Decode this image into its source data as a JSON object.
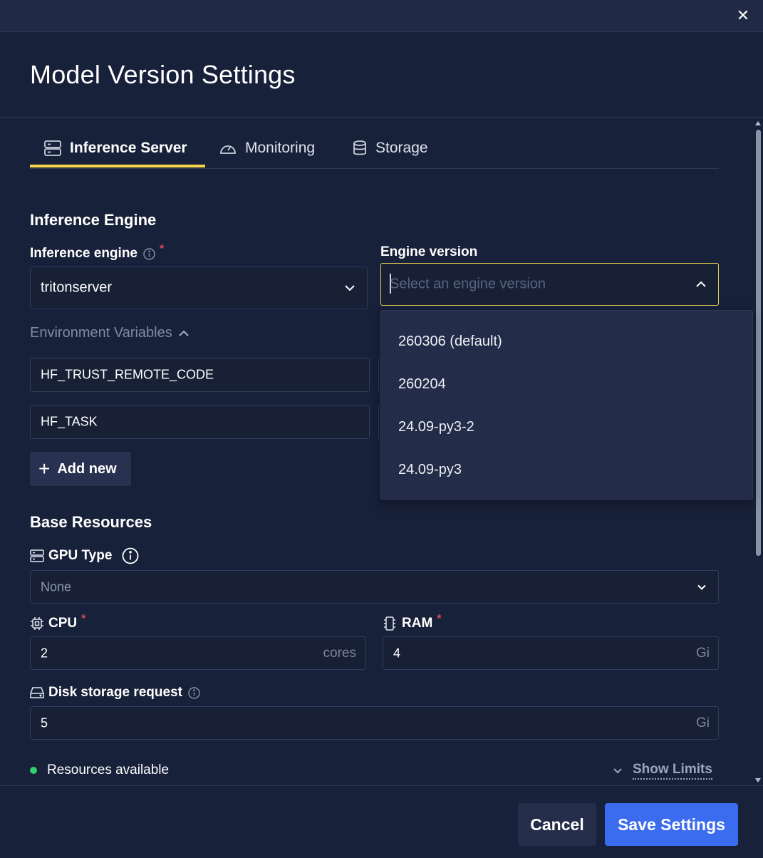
{
  "dialog": {
    "title": "Model Version Settings",
    "close_icon": "close-icon"
  },
  "tabs": [
    {
      "label": "Inference Server",
      "icon": "server-icon",
      "active": true
    },
    {
      "label": "Monitoring",
      "icon": "gauge-icon",
      "active": false
    },
    {
      "label": "Storage",
      "icon": "database-icon",
      "active": false
    }
  ],
  "inference_engine": {
    "section_title": "Inference Engine",
    "engine_label": "Inference engine",
    "engine_value": "tritonserver",
    "engine_required_mark": "*",
    "version_label": "Engine version",
    "version_placeholder": "Select an engine version",
    "version_options": [
      "260306 (default)",
      "260204",
      "24.09-py3-2",
      "24.09-py3"
    ]
  },
  "env_vars": {
    "toggle_label": "Environment Variables",
    "items": [
      "HF_TRUST_REMOTE_CODE",
      "HF_TASK"
    ],
    "add_label": "Add new"
  },
  "base_resources": {
    "section_title": "Base Resources",
    "gpu_label": "GPU Type",
    "gpu_value": "None",
    "cpu_label": "CPU",
    "cpu_value": "2",
    "cpu_unit": "cores",
    "ram_label": "RAM",
    "ram_value": "4",
    "ram_unit": "Gi",
    "disk_label": "Disk storage request",
    "disk_value": "5",
    "disk_unit": "Gi",
    "required_mark": "*"
  },
  "status": {
    "text": "Resources available",
    "color": "#2ecf6f",
    "limits_label": "Show Limits"
  },
  "footer": {
    "cancel_label": "Cancel",
    "save_label": "Save Settings"
  },
  "colors": {
    "background": "#18213a",
    "accent_tab": "#f5d547",
    "primary_button": "#3b6cf0",
    "required": "#e0485a"
  }
}
